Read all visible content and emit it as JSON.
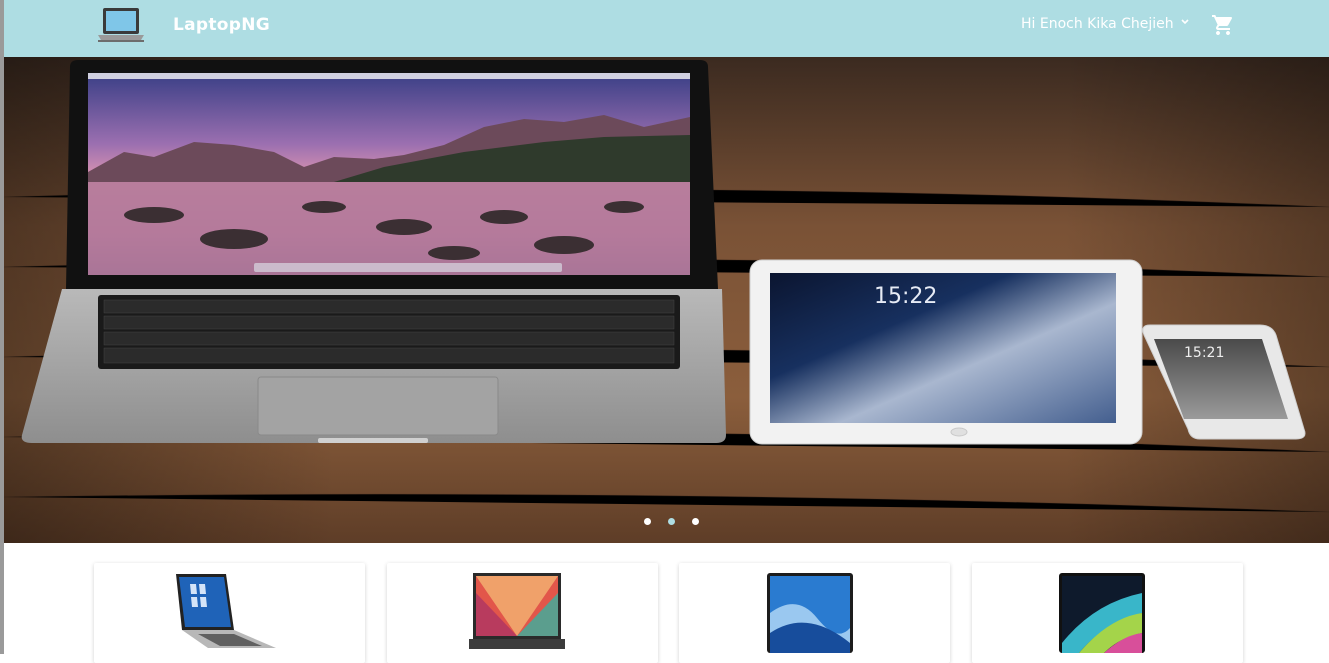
{
  "header": {
    "brand": "LaptopNG",
    "greeting": "Hi Enoch Kika Chejieh",
    "logo_icon": "laptop-icon",
    "user_menu_icon": "chevron-down-icon",
    "cart_icon": "shopping-cart-icon"
  },
  "hero": {
    "slides": 3,
    "active_slide": 2,
    "laptop_screen_time": "15:22",
    "phone_screen_time": "15:21"
  },
  "products": [
    {
      "name": "product-laptop-1"
    },
    {
      "name": "product-laptop-2"
    },
    {
      "name": "product-laptop-3"
    },
    {
      "name": "product-laptop-4"
    }
  ],
  "colors": {
    "header_bg": "#aedde3",
    "accent": "#aedde3",
    "text_light": "#ffffff"
  }
}
